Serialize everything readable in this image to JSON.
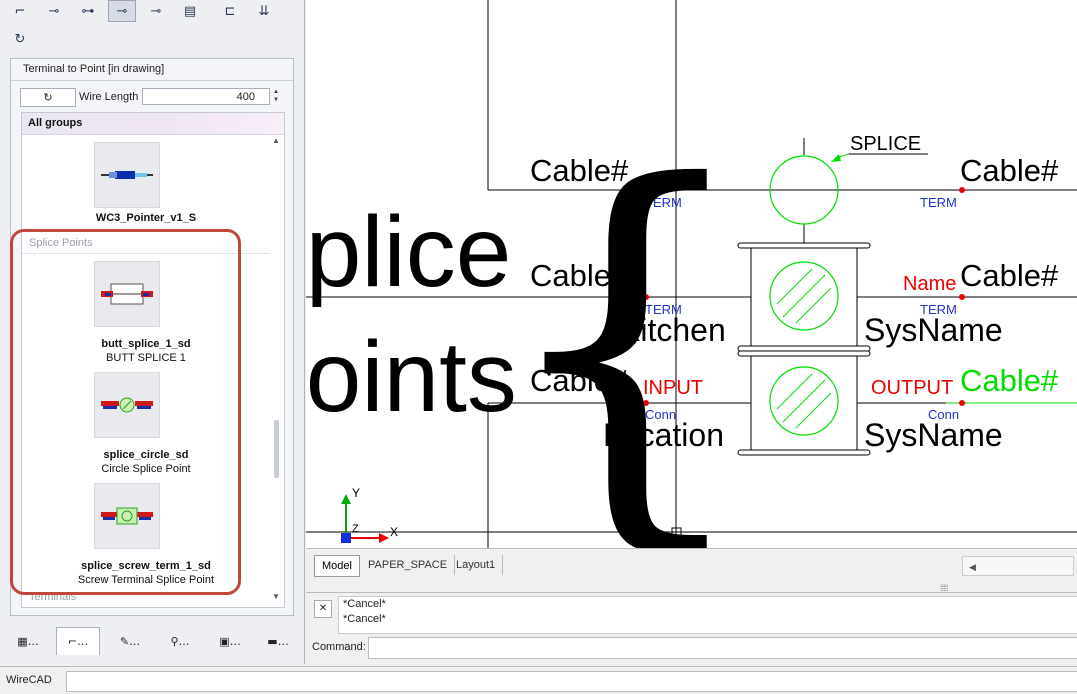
{
  "toolbar": {
    "row1": [
      "⌐",
      "⊸",
      "⊶",
      "⊸",
      "⊸",
      "▤",
      "⊏",
      "⇊"
    ],
    "row2": [
      "↻"
    ]
  },
  "panel": {
    "title": "Terminal to Point [in drawing]",
    "rotate_label": "↻",
    "wire_length_label": "Wire Length",
    "wire_length_value": "400",
    "group_header": "All groups",
    "first_item_name": "WC3_Pointer_v1_S",
    "section_splice": "Splice Points",
    "section_terminals": "Terminals",
    "items": [
      {
        "name": "butt_splice_1_sd",
        "desc": "BUTT SPLICE 1"
      },
      {
        "name": "splice_circle_sd",
        "desc": "Circle Splice Point"
      },
      {
        "name": "splice_screw_term_1_sd",
        "desc": "Screw Terminal Splice Point"
      }
    ]
  },
  "bottom_tabs": [
    "…",
    "…",
    "…",
    "…",
    "…",
    "…"
  ],
  "drawing": {
    "overlay_line1": "Splice",
    "overlay_line2": "Points",
    "brace": "{",
    "splice_label": "SPLICE",
    "cable": "Cable#",
    "term": "TERM",
    "name": "Name",
    "kitchen": "Kitchen",
    "sysname": "SysName",
    "input": "INPUT",
    "output": "OUTPUT",
    "conn": "Conn",
    "location": "Location",
    "axis_y": "Y",
    "axis_x": "X",
    "axis_z": "Z",
    "colors": {
      "green": "#00dd00",
      "red": "#ee0000",
      "blue": "#2233cc"
    }
  },
  "layout_tabs": [
    "Model",
    "PAPER_SPACE",
    "Layout1"
  ],
  "command": {
    "history": [
      "*Cancel*",
      "*Cancel*"
    ],
    "label": "Command:",
    "close": "✕"
  },
  "status": {
    "app": "WireCAD"
  }
}
